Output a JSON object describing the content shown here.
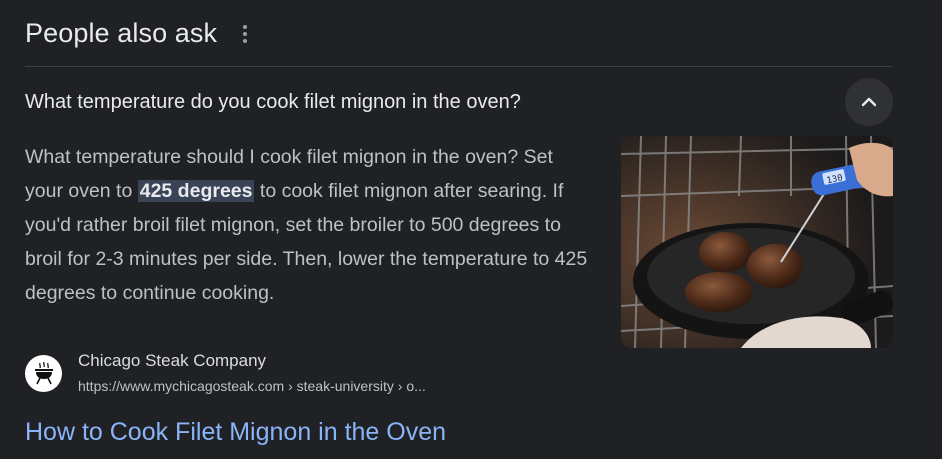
{
  "header": {
    "title": "People also ask",
    "more_icon": "more-vert-icon"
  },
  "question": {
    "text": "What temperature do you cook filet mignon in the oven?",
    "toggle_icon": "chevron-up-icon"
  },
  "answer": {
    "before": "What temperature should I cook filet mignon in the oven? Set your oven to ",
    "highlight": "425 degrees",
    "after": " to cook filet mignon after searing. If you'd rather broil filet mignon, set the broiler to 500 degrees to broil for 2-3 minutes per side. Then, lower the temperature to 425 degrees to continue cooking."
  },
  "thermometer_reading": "130",
  "source": {
    "name": "Chicago Steak Company",
    "url": "https://www.mychicagosteak.com › steak-university › o...",
    "favicon": "grill-icon"
  },
  "result_title": "How to Cook Filet Mignon in the Oven",
  "colors": {
    "background": "#202124",
    "link": "#8ab4f8",
    "highlight_bg": "#394457"
  }
}
